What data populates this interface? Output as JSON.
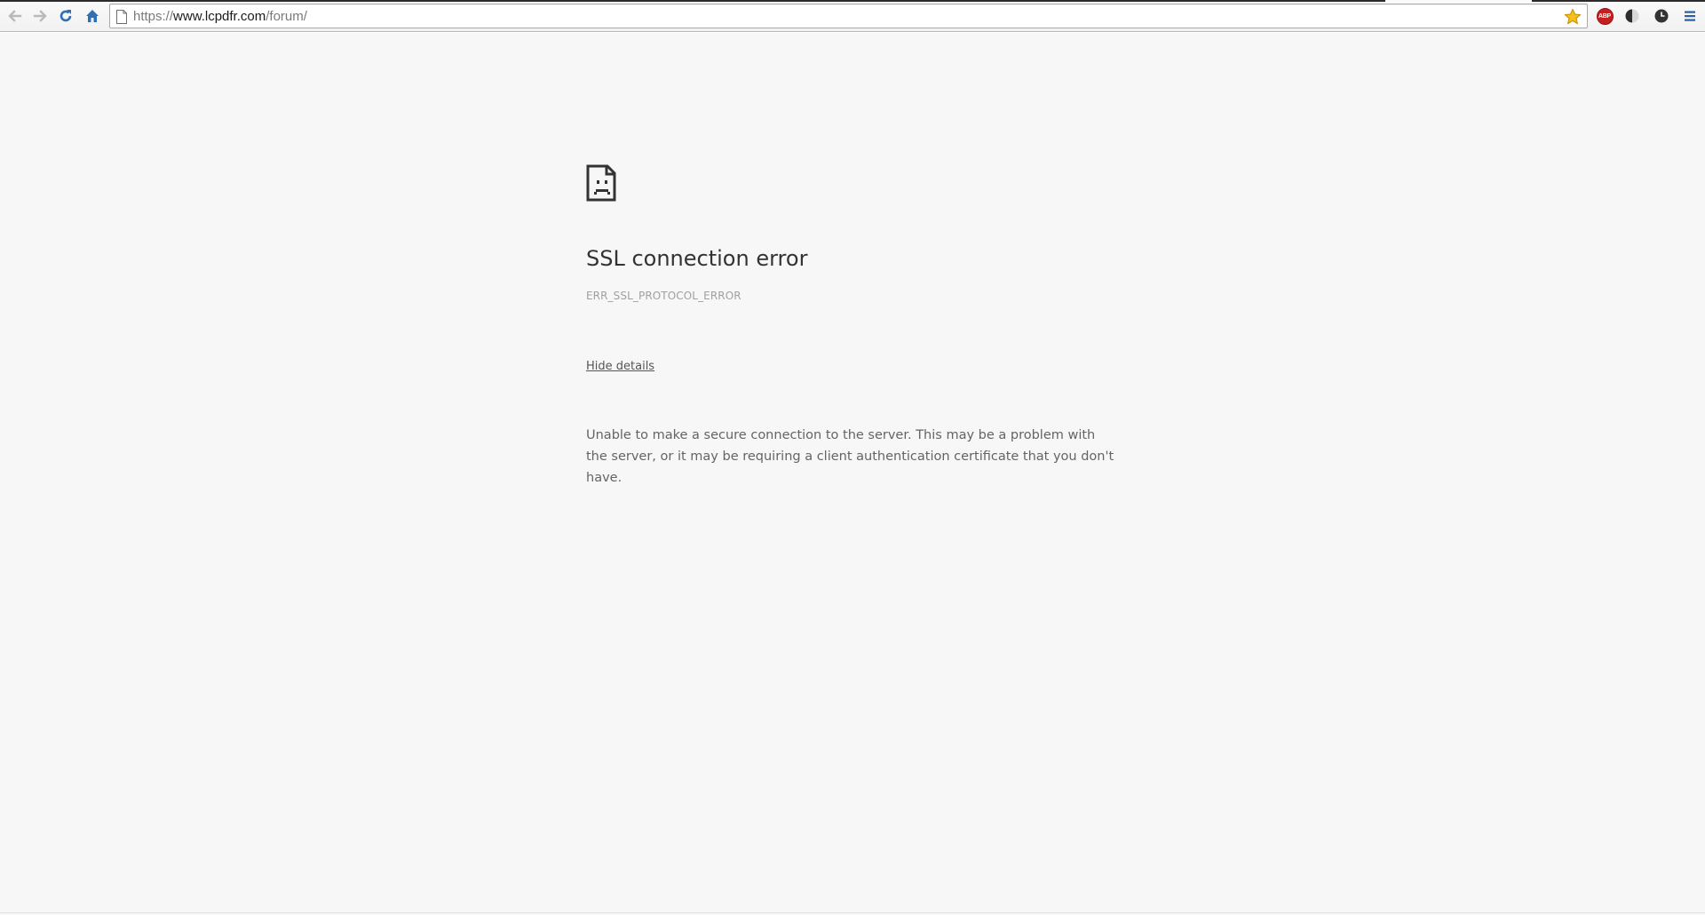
{
  "browser": {
    "url": {
      "scheme": "https://",
      "host": "www.lcpdfr.com",
      "path": "/forum/"
    },
    "extensions": {
      "adblock_label": "ABP"
    },
    "icons": {
      "back": "back-arrow-icon",
      "forward": "forward-arrow-icon",
      "reload": "reload-icon",
      "home": "home-icon",
      "page": "page-icon",
      "bookmark": "star-icon",
      "menu": "hamburger-menu-icon"
    },
    "colors": {
      "nav_blue": "#2f6fb6",
      "star_yellow": "#f4c11c",
      "abp_red": "#c51f1f"
    }
  },
  "error_page": {
    "title": "SSL connection error",
    "code": "ERR_SSL_PROTOCOL_ERROR",
    "details_link": "Hide details",
    "description": "Unable to make a secure connection to the server. This may be a problem with the server, or it may be requiring a client authentication certificate that you don't have."
  }
}
